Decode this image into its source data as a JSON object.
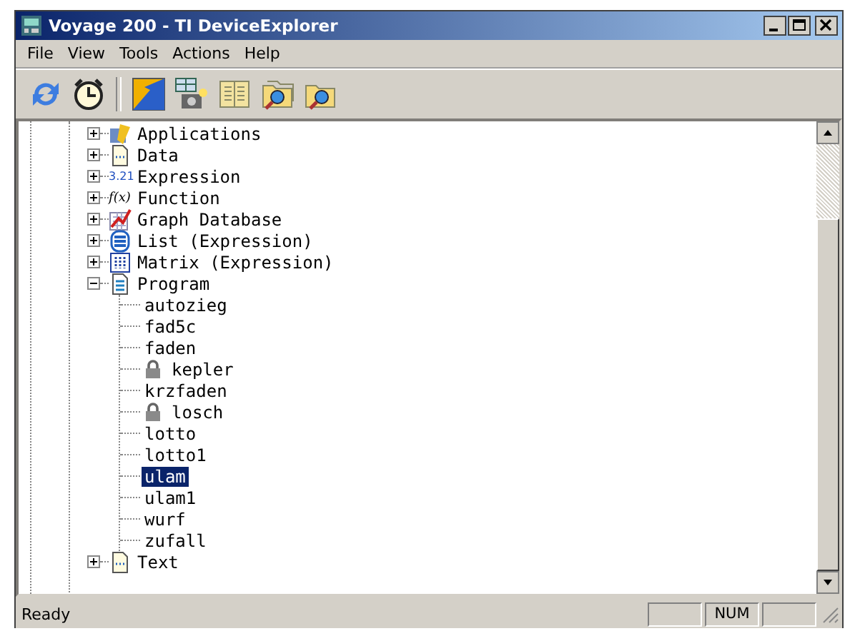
{
  "window": {
    "title": "Voyage 200 - TI DeviceExplorer"
  },
  "menu": [
    "File",
    "View",
    "Tools",
    "Actions",
    "Help"
  ],
  "tree": [
    {
      "label": "Applications",
      "expanded": false
    },
    {
      "label": "Data",
      "expanded": false
    },
    {
      "label": "Expression",
      "expanded": false,
      "icon_text": "3.21"
    },
    {
      "label": "Function",
      "expanded": false,
      "icon_text": "f(x)"
    },
    {
      "label": "Graph Database",
      "expanded": false
    },
    {
      "label": "List (Expression)",
      "expanded": false
    },
    {
      "label": "Matrix (Expression)",
      "expanded": false
    },
    {
      "label": "Program",
      "expanded": true,
      "children": [
        {
          "label": "autozieg",
          "locked": false,
          "selected": false
        },
        {
          "label": "fad5c",
          "locked": false,
          "selected": false
        },
        {
          "label": "faden",
          "locked": false,
          "selected": false
        },
        {
          "label": "kepler",
          "locked": true,
          "selected": false
        },
        {
          "label": "krzfaden",
          "locked": false,
          "selected": false
        },
        {
          "label": "losch",
          "locked": true,
          "selected": false
        },
        {
          "label": "lotto",
          "locked": false,
          "selected": false
        },
        {
          "label": "lotto1",
          "locked": false,
          "selected": false
        },
        {
          "label": "ulam",
          "locked": false,
          "selected": true
        },
        {
          "label": "ulam1",
          "locked": false,
          "selected": false
        },
        {
          "label": "wurf",
          "locked": false,
          "selected": false
        },
        {
          "label": "zufall",
          "locked": false,
          "selected": false
        }
      ]
    },
    {
      "label": "Text",
      "expanded": false
    }
  ],
  "status_bar": {
    "message": "Ready",
    "num_indicator": "NUM"
  }
}
